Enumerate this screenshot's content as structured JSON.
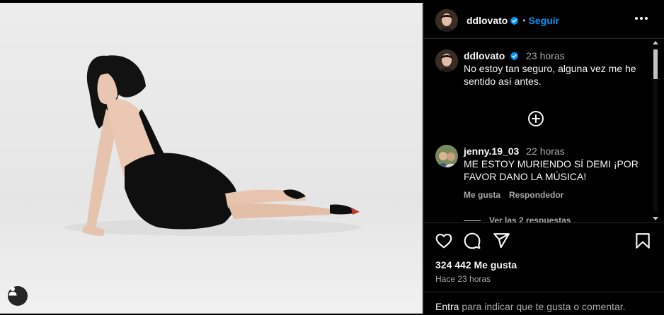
{
  "post": {
    "username": "ddlovato",
    "follow_label": "Seguir",
    "dot": "•",
    "caption": {
      "username": "ddlovato",
      "time": "23 horas",
      "text": "No estoy tan seguro, alguna vez me he sentido así antes."
    },
    "comment": {
      "username": "jenny.19_03",
      "time": "22 horas",
      "text": "ME ESTOY MURIENDO SÍ DEMI ¡POR FAVOR DANO LA MÚSICA!",
      "like_label": "Me gusta",
      "reply_label": "Respondedor",
      "view_replies": "Ver las 2 respuestas"
    },
    "likes": "324 442 Me gusta",
    "posted_ago": "Hace 23 horas",
    "login_prompt_link": "Entra",
    "login_prompt_rest": " para indicar que te gusta o comentar."
  },
  "colors": {
    "accent": "#0095f6",
    "verified": "#0095f6",
    "background": "#000000",
    "secondary_text": "#a8a8a8"
  },
  "icons": {
    "like": "heart-icon",
    "comment": "comment-icon",
    "share": "paper-plane-icon",
    "save": "bookmark-icon",
    "more": "ellipsis-icon",
    "load_more": "plus-circle-icon",
    "tag": "user-icon",
    "verified": "verified-badge-icon"
  }
}
